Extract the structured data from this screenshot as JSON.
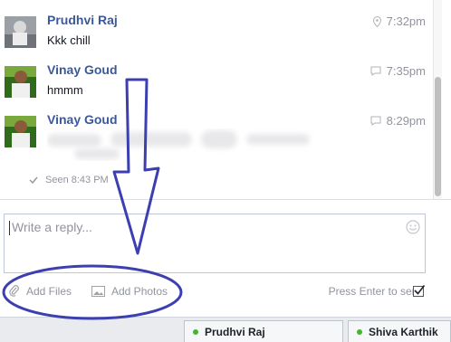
{
  "thread": {
    "messages": [
      {
        "sender": "Prudhvi Raj",
        "text": "Kkk chill",
        "time": "7:32pm",
        "source_icon": "location-pin-icon"
      },
      {
        "sender": "Vinay Goud",
        "text": "hmmm",
        "time": "7:35pm",
        "source_icon": "chat-bubble-icon"
      },
      {
        "sender": "Vinay Goud",
        "text": "",
        "time": "8:29pm",
        "source_icon": "chat-bubble-icon"
      }
    ],
    "seen": "Seen 8:43 PM"
  },
  "composer": {
    "placeholder": "Write a reply...",
    "add_files": "Add Files",
    "add_photos": "Add Photos",
    "press_enter": "Press Enter to send",
    "press_enter_checked": true
  },
  "chat_tabs": [
    {
      "name": "Prudhvi Raj",
      "online": true
    },
    {
      "name": "Shiva Karthik",
      "online": true
    }
  ],
  "annotation": {
    "color": "#3b3fb0",
    "shapes": [
      "down-arrow",
      "ellipse"
    ]
  }
}
